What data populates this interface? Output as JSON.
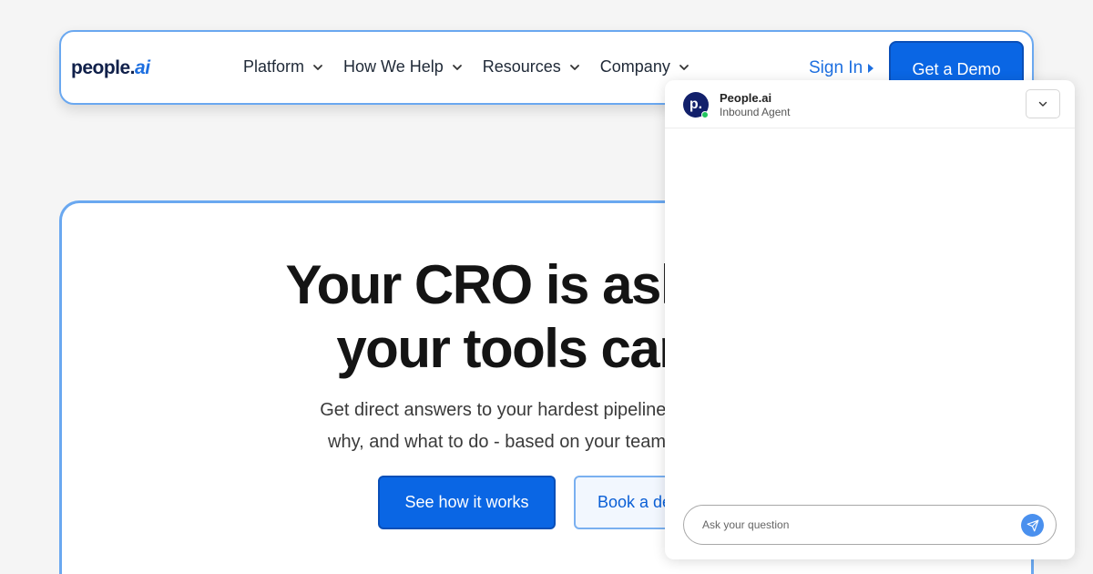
{
  "nav": {
    "logo": {
      "main": "people.",
      "accent": "ai"
    },
    "items": [
      {
        "label": "Platform"
      },
      {
        "label": "How We Help"
      },
      {
        "label": "Resources"
      },
      {
        "label": "Company"
      }
    ],
    "signin": "Sign In",
    "demo": "Get a Demo"
  },
  "hero": {
    "title_line1": "Your CRO is asking q",
    "title_line2": "your tools can't a",
    "subtitle_line1": "Get direct answers to your hardest pipeline questions - w",
    "subtitle_line2": "why, and what to do - based on your team's actual cust",
    "cta_primary": "See how it works",
    "cta_secondary": "Book a de"
  },
  "chat": {
    "avatar_letter": "p.",
    "name": "People.ai",
    "role": "Inbound Agent",
    "placeholder": "Ask your question",
    "icons": {
      "collapse": "chevron-down-icon",
      "send": "send-icon"
    }
  },
  "colors": {
    "brand": "#0a66e4",
    "outline": "#6aa8f0",
    "online": "#22c55e",
    "avatar": "#12206b"
  }
}
